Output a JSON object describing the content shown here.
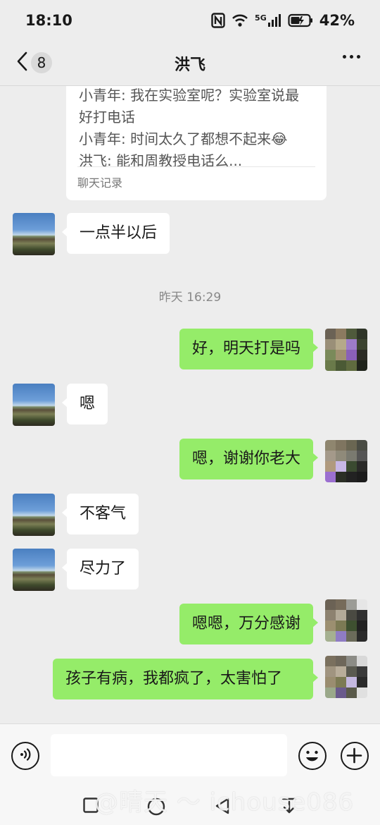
{
  "status_bar": {
    "time": "18:10",
    "network": "5G",
    "battery": "42%"
  },
  "header": {
    "back_count": "8",
    "title": "洪飞"
  },
  "chat_record": {
    "lines": [
      "小青年: 我在实验室呢？实验室说最",
      "好打电话",
      "小青年: 时间太久了都想不起来😂",
      "洪飞: 能和周教授电话么..."
    ],
    "label": "聊天记录"
  },
  "messages": [
    {
      "side": "left",
      "text": "一点半以后"
    },
    {
      "side": "time",
      "text": "昨天 16:29"
    },
    {
      "side": "right",
      "text": "好，明天打是吗"
    },
    {
      "side": "left",
      "text": "嗯"
    },
    {
      "side": "right",
      "text": "嗯，谢谢你老大"
    },
    {
      "side": "left",
      "text": "不客气"
    },
    {
      "side": "left",
      "text": "尽力了"
    },
    {
      "side": "right",
      "text": "嗯嗯，万分感谢"
    },
    {
      "side": "right",
      "text": "孩子有病，我都疯了，太害怕了"
    }
  ],
  "input": {
    "value": ""
  },
  "watermark": "@晴天 ～ ichouse086"
}
